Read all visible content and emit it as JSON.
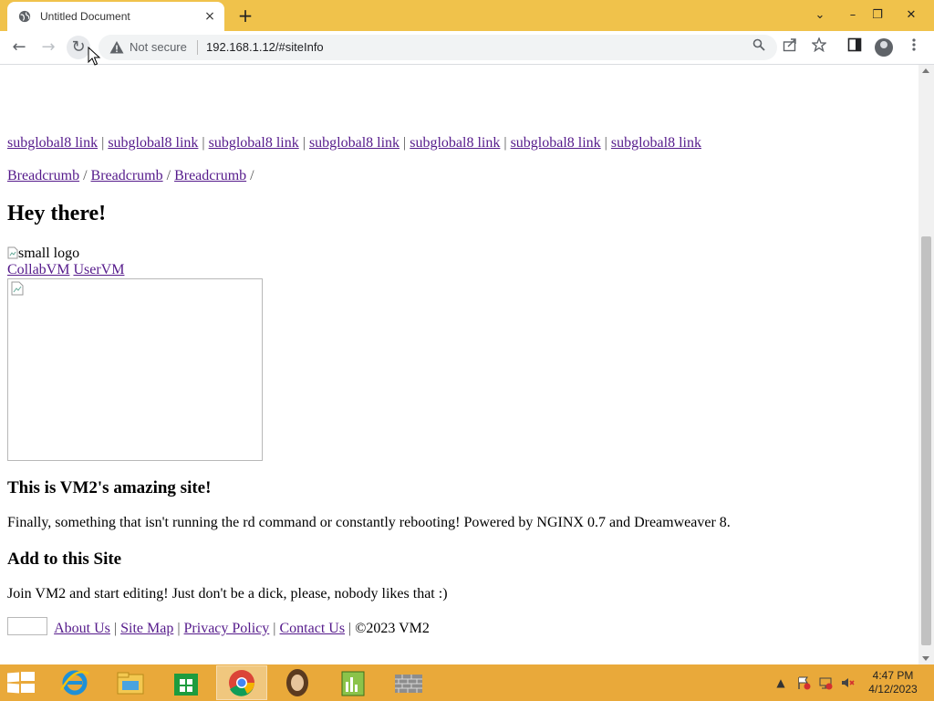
{
  "browser": {
    "tab_title": "Untitled Document",
    "tab_close_icon": "×",
    "new_tab_icon": "+",
    "window_controls": {
      "tabsearch": "⌄",
      "minimize": "–",
      "restore": "❐",
      "close": "✕"
    },
    "nav": {
      "back": "←",
      "forward": "→",
      "reload": "↻"
    },
    "security_label": "Not secure",
    "url": "192.168.1.12/#siteInfo",
    "accent_color": "#f0c24b"
  },
  "page": {
    "subglobal_links": [
      "subglobal8 link",
      "subglobal8 link",
      "subglobal8 link",
      "subglobal8 link",
      "subglobal8 link",
      "subglobal8 link",
      "subglobal8 link"
    ],
    "link_separator": "|",
    "breadcrumbs": [
      "Breadcrumb",
      "Breadcrumb",
      "Breadcrumb"
    ],
    "breadcrumb_separator": "/",
    "heading": "Hey there!",
    "logo_alt": "small logo",
    "vm_links": [
      "CollabVM",
      "UserVM"
    ],
    "subheading": "This is VM2's amazing site!",
    "intro": "Finally, something that isn't running the rd command or constantly rebooting! Powered by NGINX 0.7 and Dreamweaver 8.",
    "add_heading": "Add to this Site",
    "join_text": "Join VM2 and start editing! Just don't be a dick, please, nobody likes that :)",
    "footer_links": [
      "About Us",
      "Site Map",
      "Privacy Policy",
      "Contact Us"
    ],
    "copyright": "©2023 VM2"
  },
  "taskbar": {
    "time": "4:47 PM",
    "date": "4/12/2023",
    "color": "#e9a93a",
    "items": [
      "internet-explorer-icon",
      "file-explorer-icon",
      "store-icon",
      "chrome-icon",
      "app-portrait-icon",
      "notepad-chart-icon",
      "brick-wall-icon"
    ]
  }
}
